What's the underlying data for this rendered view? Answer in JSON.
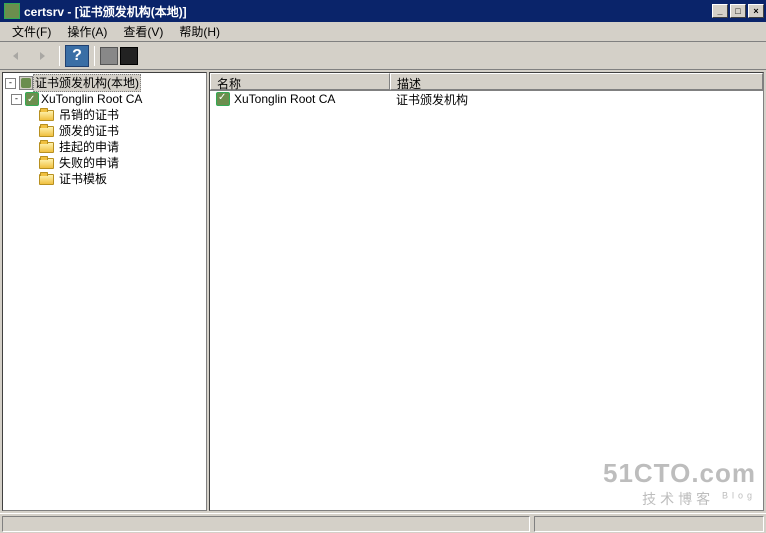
{
  "window": {
    "title": "certsrv - [证书颁发机构(本地)]",
    "controls": {
      "minimize": "_",
      "maximize": "□",
      "close": "×"
    }
  },
  "menu": {
    "file": "文件(F)",
    "action": "操作(A)",
    "view": "查看(V)",
    "help": "帮助(H)"
  },
  "toolbar": {
    "back": "←",
    "forward": "→",
    "help": "?",
    "btn1": " ",
    "btn2": " "
  },
  "tree": {
    "root_label": "证书颁发机构(本地)",
    "ca_label": "XuTonglin Root CA",
    "children": [
      {
        "label": "吊销的证书"
      },
      {
        "label": "颁发的证书"
      },
      {
        "label": "挂起的申请"
      },
      {
        "label": "失败的申请"
      },
      {
        "label": "证书模板"
      }
    ],
    "toggle_minus": "-"
  },
  "list": {
    "columns": {
      "name": "名称",
      "description": "描述"
    },
    "rows": [
      {
        "name": "XuTonglin Root CA",
        "description": "证书颁发机构"
      }
    ]
  },
  "watermark": {
    "line1": "51CTO.com",
    "line2": "技术博客",
    "blog": "Blog"
  }
}
